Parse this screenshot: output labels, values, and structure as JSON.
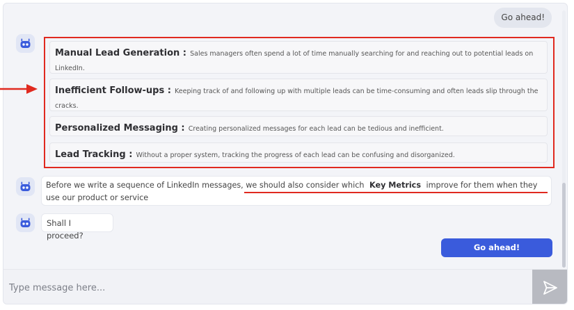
{
  "chat": {
    "user_message": "Go ahead!",
    "lead_items": [
      {
        "title": "Manual Lead Generation :",
        "desc": "Sales managers often spend a lot of time manually searching for and reaching out to potential leads on LinkedIn."
      },
      {
        "title": "Inefficient Follow-ups :",
        "desc": "Keeping track of and following up with multiple leads can be time-consuming and often leads slip through the cracks."
      },
      {
        "title": "Personalized Messaging :",
        "desc": "Creating personalized messages for each lead can be tedious and inefficient."
      },
      {
        "title": "Lead Tracking :",
        "desc": "Without a proper system, tracking the progress of each lead can be confusing and disorganized."
      }
    ],
    "bot_message_1": {
      "part1": "Before we write a sequence of LinkedIn messages, we should also consider which",
      "emphasis": "Key Metrics",
      "part2": "improve for them when they use our product or service"
    },
    "bot_message_2": "Shall I proceed?",
    "cta_label": "Go ahead!"
  },
  "composer": {
    "placeholder": "Type message here..."
  },
  "colors": {
    "accent": "#3a5bdc",
    "annotation_red": "#e0291f",
    "panel_bg": "#f3f4f8",
    "send_button": "#b8bac1"
  },
  "icons": [
    "robot-avatar-icon",
    "red-arrow-icon",
    "send-icon"
  ]
}
